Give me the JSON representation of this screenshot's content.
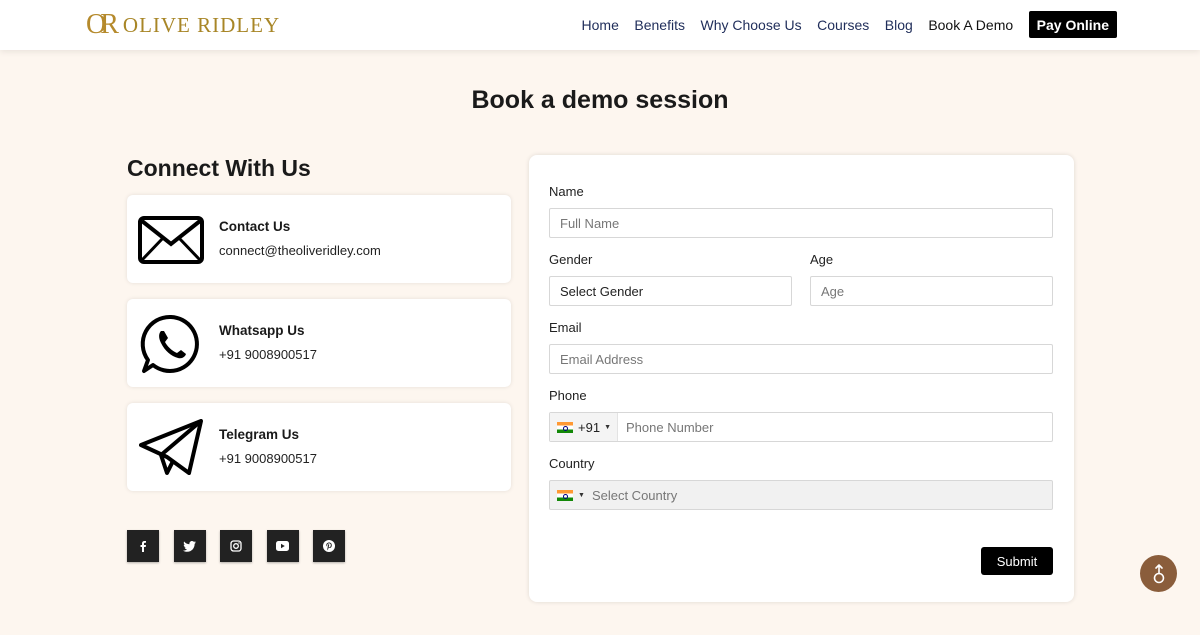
{
  "header": {
    "logo_mark": "OR",
    "logo_text": "OLIVE RIDLEY",
    "nav": [
      "Home",
      "Benefits",
      "Why Choose Us",
      "Courses",
      "Blog",
      "Book A Demo"
    ],
    "pay_button": "Pay Online"
  },
  "page_title": "Book a demo session",
  "connect": {
    "title": "Connect With Us",
    "cards": [
      {
        "title": "Contact Us",
        "value": "connect@theoliveridley.com",
        "icon": "envelope-icon"
      },
      {
        "title": "Whatsapp Us",
        "value": "+91 9008900517",
        "icon": "whatsapp-icon"
      },
      {
        "title": "Telegram Us",
        "value": "+91 9008900517",
        "icon": "telegram-icon"
      }
    ],
    "socials": [
      "facebook-icon",
      "twitter-icon",
      "instagram-icon",
      "youtube-icon",
      "pinterest-icon"
    ]
  },
  "form": {
    "name_label": "Name",
    "name_placeholder": "Full Name",
    "gender_label": "Gender",
    "gender_value": "Select Gender",
    "age_label": "Age",
    "age_placeholder": "Age",
    "email_label": "Email",
    "email_placeholder": "Email Address",
    "phone_label": "Phone",
    "phone_code": "+91",
    "phone_placeholder": "Phone Number",
    "country_label": "Country",
    "country_placeholder": "Select Country",
    "submit": "Submit"
  }
}
